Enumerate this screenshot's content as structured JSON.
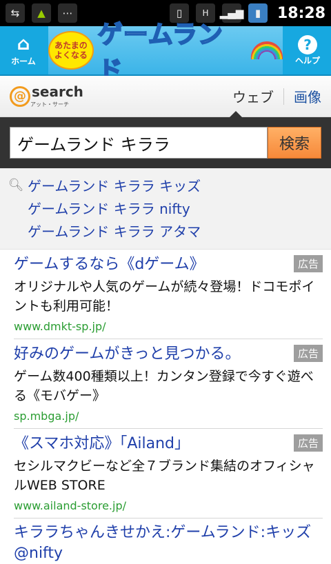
{
  "status": {
    "time": "18:28",
    "left_icons": [
      "usb-icon",
      "android-icon",
      "more-icon"
    ],
    "right_icons": [
      "vibrate-icon",
      "data-icon",
      "signal-icon",
      "battery-icon"
    ]
  },
  "appbar": {
    "home_label": "ホーム",
    "help_label": "ヘルプ",
    "logo_badge": "あたまの よくなる",
    "logo_text": "ゲームランド"
  },
  "search_header": {
    "brand": "search",
    "brand_sub": "アット・サーチ",
    "tab_web": "ウェブ",
    "tab_image": "画像"
  },
  "search": {
    "query": "ゲームランド キララ",
    "button": "検索"
  },
  "suggestions": [
    "ゲームランド キララ キッズ",
    "ゲームランド キララ nifty",
    "ゲームランド キララ アタマ"
  ],
  "ads": [
    {
      "title": "ゲームするなら《dゲーム》",
      "badge": "広告",
      "desc": "オリジナルや人気のゲームが続々登場！ドコモポイントも利用可能！",
      "url": "www.dmkt-sp.jp/"
    },
    {
      "title": "好みのゲームがきっと見つかる。",
      "badge": "広告",
      "desc": "ゲーム数400種類以上！カンタン登録で今すぐ遊べる《モバゲー》",
      "url": "sp.mbga.jp/"
    },
    {
      "title": "《スマホ対応》「Ailand」",
      "badge": "広告",
      "desc": "セシルマクビーなど全７ブランド集結のオフィシャルWEB STORE",
      "url": "www.ailand-store.jp/"
    }
  ],
  "last_result": {
    "title": "キララちゃんきせかえ:ゲームランド:キッズ@nifty"
  }
}
